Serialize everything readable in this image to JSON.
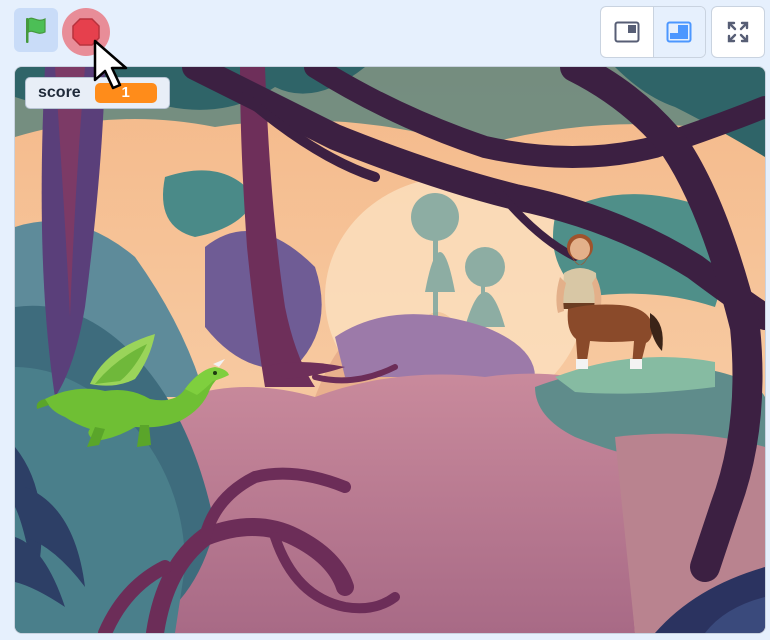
{
  "toolbar": {
    "green_flag_icon": "green-flag-icon",
    "stop_icon": "stop-sign-icon",
    "small_stage_icon": "small-stage-icon",
    "normal_stage_icon": "normal-stage-icon",
    "fullscreen_icon": "fullscreen-icon"
  },
  "monitor": {
    "label": "score",
    "value": "1",
    "value_color": "#ff8c1a"
  },
  "stage": {
    "backdrop": "jungle",
    "sprites": [
      "dragon",
      "centaur"
    ]
  },
  "colors": {
    "page_bg": "#e6f0fd",
    "flag_green": "#4cbf56",
    "stop_red": "#e6404d",
    "accent_blue": "#4c97ff"
  }
}
